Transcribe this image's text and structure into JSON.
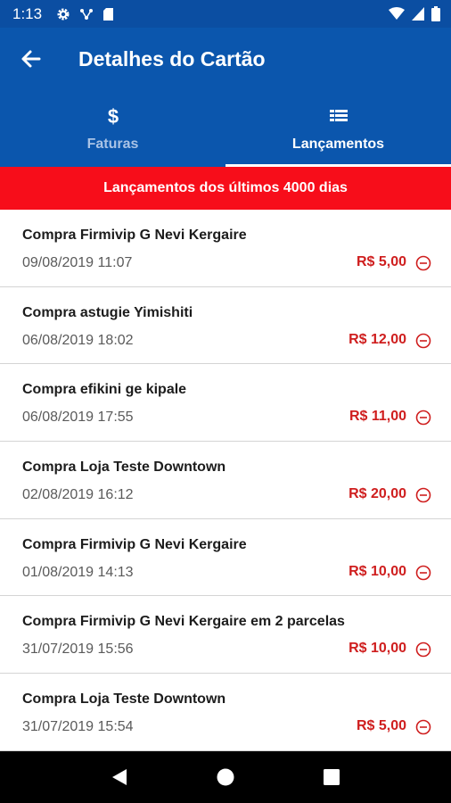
{
  "status_bar": {
    "time": "1:13",
    "icons": [
      "gear-icon",
      "network-icon",
      "sd-card-icon"
    ],
    "right_icons": [
      "wifi-icon",
      "signal-icon",
      "battery-icon"
    ]
  },
  "app_bar": {
    "title": "Detalhes do Cartão",
    "back_icon": "arrow-left-icon"
  },
  "tabs": [
    {
      "label": "Faturas",
      "icon": "dollar-icon",
      "active": false
    },
    {
      "label": "Lançamentos",
      "icon": "list-icon",
      "active": true
    }
  ],
  "banner": {
    "text": "Lançamentos dos últimos 4000 dias"
  },
  "colors": {
    "primary": "#0b56ad",
    "status_bar": "#0b4ea2",
    "banner": "#f70d1a",
    "amount": "#cf1e1e"
  },
  "transactions": [
    {
      "description": "Compra Firmivip G Nevi Kergaire",
      "datetime": "09/08/2019 11:07",
      "amount": "R$ 5,00"
    },
    {
      "description": "Compra astugie Yimishiti",
      "datetime": "06/08/2019 18:02",
      "amount": "R$ 12,00"
    },
    {
      "description": "Compra efikini ge kipale",
      "datetime": "06/08/2019 17:55",
      "amount": "R$ 11,00"
    },
    {
      "description": "Compra Loja Teste Downtown",
      "datetime": "02/08/2019 16:12",
      "amount": "R$ 20,00"
    },
    {
      "description": "Compra Firmivip G Nevi Kergaire",
      "datetime": "01/08/2019 14:13",
      "amount": "R$ 10,00"
    },
    {
      "description": "Compra Firmivip G Nevi Kergaire em 2 parcelas",
      "datetime": "31/07/2019 15:56",
      "amount": "R$ 10,00"
    },
    {
      "description": "Compra Loja Teste Downtown",
      "datetime": "31/07/2019 15:54",
      "amount": "R$ 5,00"
    }
  ],
  "nav_bar": {
    "buttons": [
      "back-triangle-icon",
      "home-circle-icon",
      "recents-square-icon"
    ]
  }
}
